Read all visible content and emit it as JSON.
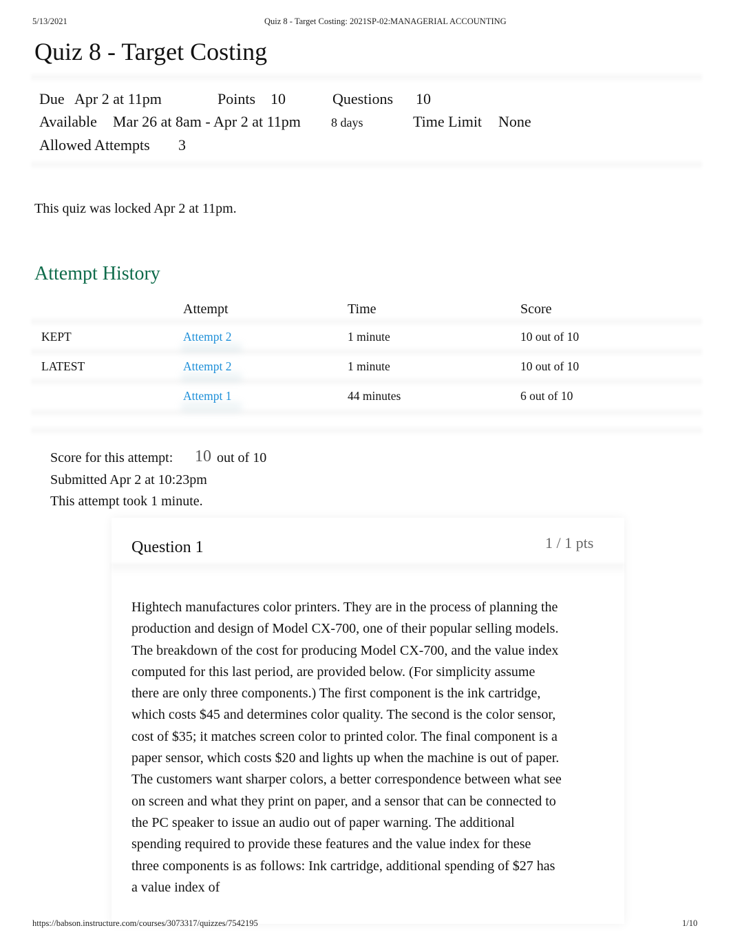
{
  "print_header": {
    "date": "5/13/2021",
    "document_title": "Quiz 8 - Target Costing: 2021SP-02:MANAGERIAL ACCOUNTING"
  },
  "page_title": "Quiz 8 - Target Costing",
  "quiz_details": {
    "due_label": "Due",
    "due_value": "Apr 2 at 11pm",
    "points_label": "Points",
    "points_value": "10",
    "questions_label": "Questions",
    "questions_value": "10",
    "available_label": "Available",
    "available_value": "Mar 26 at 8am - Apr 2 at 11pm",
    "available_duration": "8 days",
    "time_limit_label": "Time Limit",
    "time_limit_value": "None",
    "allowed_attempts_label": "Allowed Attempts",
    "allowed_attempts_value": "3"
  },
  "locked_message": "This quiz was locked Apr 2 at 11pm.",
  "attempt_history": {
    "title": "Attempt History",
    "columns": [
      "",
      "Attempt",
      "Time",
      "Score"
    ],
    "rows": [
      {
        "status": "KEPT",
        "attempt": "Attempt 2",
        "time": "1 minute",
        "score": "10 out of 10"
      },
      {
        "status": "LATEST",
        "attempt": "Attempt 2",
        "time": "1 minute",
        "score": "10 out of 10"
      },
      {
        "status": "",
        "attempt": "Attempt 1",
        "time": "44 minutes",
        "score": "6 out of 10"
      }
    ]
  },
  "attempt_summary": {
    "score_label": "Score for this attempt:",
    "score_value": "10",
    "score_suffix": "out of 10",
    "submitted": "Submitted Apr 2 at 10:23pm",
    "duration": "This attempt took 1 minute."
  },
  "question": {
    "title": "Question 1",
    "points": "1 / 1 pts",
    "body": "Hightech manufactures color printers. They are in the process of planning the production and design of Model CX-700, one of their popular selling models. The breakdown of the cost for producing Model CX-700, and the value index computed for this last period, are provided below. (For simplicity assume there are only three components.) The first component is the ink cartridge, which costs $45 and determines color quality. The second is the color sensor, cost of $35; it matches screen color to printed color. The final component is a paper sensor, which costs $20 and lights up when the machine is out of paper. The customers want sharper colors, a better correspondence between what see on screen and what they print on paper, and a sensor that can be connected to the PC speaker to issue an audio out of paper warning. The additional spending required to provide these features and the value index for these three components is as follows: Ink cartridge, additional spending of $27 has a value index of"
  },
  "print_footer": {
    "url": "https://babson.instructure.com/courses/3073317/quizzes/7542195",
    "page_number": "1/10"
  },
  "colors": {
    "heading_green": "#0e6b4a",
    "link_blue": "#1d8fd8",
    "muted_gray": "#666666"
  }
}
